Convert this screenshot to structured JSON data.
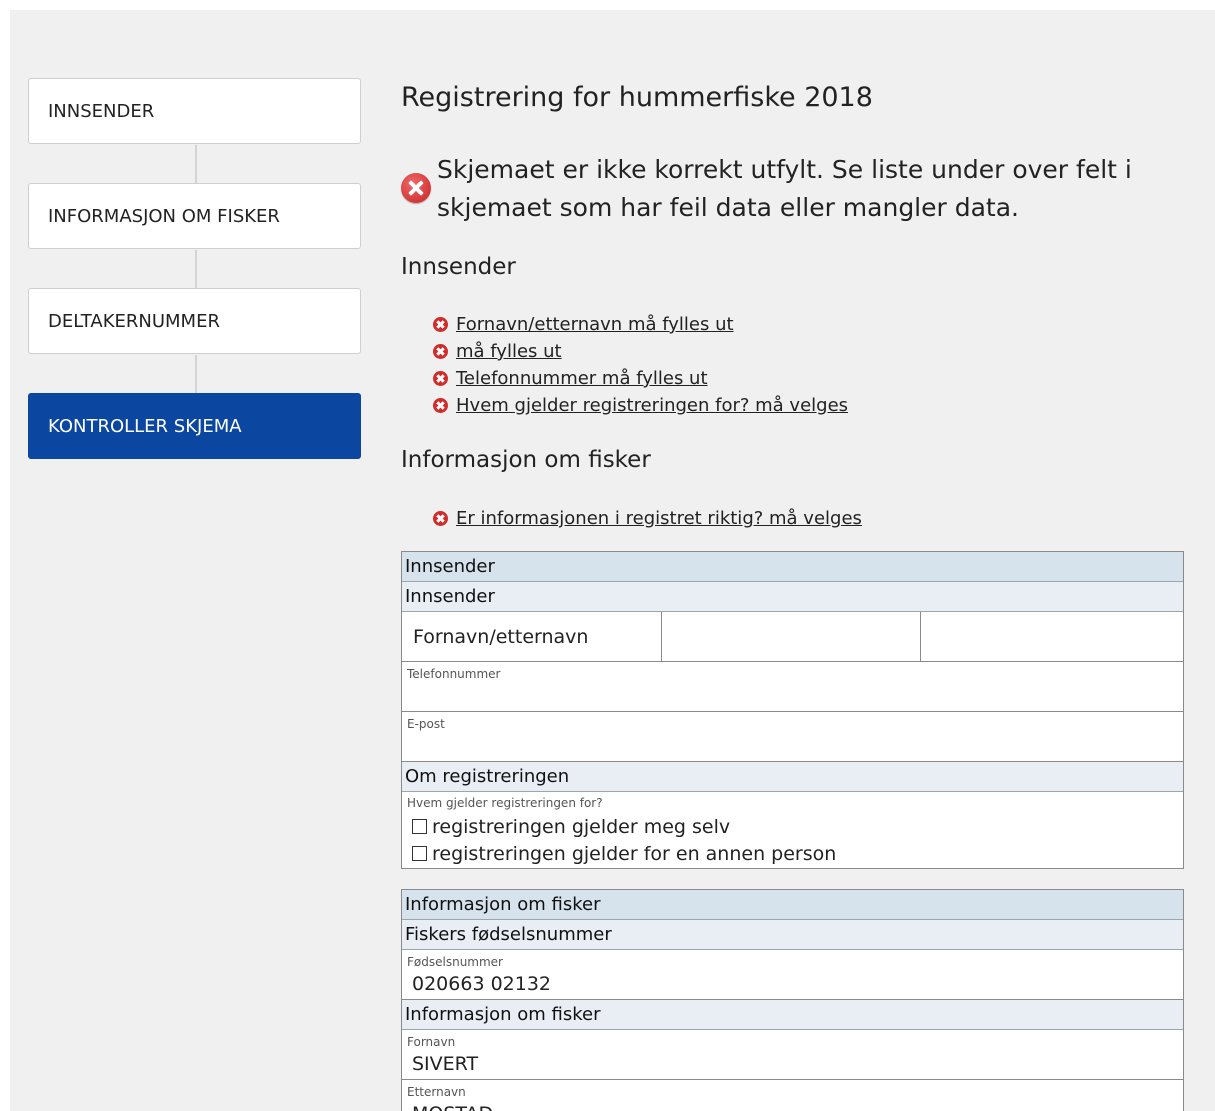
{
  "sidebar": {
    "steps": [
      {
        "label": "INNSENDER"
      },
      {
        "label": "INFORMASJON OM FISKER"
      },
      {
        "label": "DELTAKERNUMMER"
      },
      {
        "label": "KONTROLLER SKJEMA"
      }
    ]
  },
  "main": {
    "title": "Registrering for hummerfiske 2018",
    "alert": "Skjemaet er ikke korrekt utfylt. Se liste under over felt i skjemaet som har feil data eller mangler data.",
    "error_sections": [
      {
        "heading": "Innsender",
        "errors": [
          "Fornavn/etternavn må fylles ut",
          "må fylles ut",
          "Telefonnummer må fylles ut",
          "Hvem gjelder registreringen for? må velges"
        ]
      },
      {
        "heading": "Informasjon om fisker",
        "errors": [
          "Er informasjonen i registret riktig? må velges"
        ]
      }
    ]
  },
  "summary": {
    "innsender": {
      "header": "Innsender",
      "subheader": "Innsender",
      "name_label": "Fornavn/etternavn",
      "name_first": "",
      "name_last": "",
      "phone_label": "Telefonnummer",
      "phone_value": "",
      "email_label": "E-post",
      "email_value": "",
      "reg_header": "Om registreringen",
      "reg_question": "Hvem gjelder registreringen for?",
      "options": [
        {
          "label": "registreringen gjelder meg selv",
          "checked": false
        },
        {
          "label": "registreringen gjelder for en annen person",
          "checked": false
        }
      ]
    },
    "fisker": {
      "header": "Informasjon om fisker",
      "sub1": "Fiskers fødselsnummer",
      "fnr_label": "Fødselsnummer",
      "fnr_value": "020663 02132",
      "sub2": "Informasjon om fisker",
      "fornavn_label": "Fornavn",
      "fornavn_value": "SIVERT",
      "etternavn_label": "Etternavn",
      "etternavn_value": "MOSTAD"
    }
  }
}
